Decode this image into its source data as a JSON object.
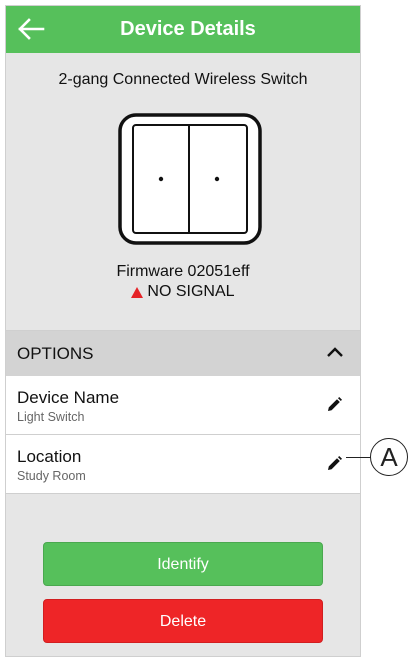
{
  "header": {
    "title": "Device Details",
    "back_icon": "arrow-left-icon"
  },
  "device": {
    "name": "2-gang Connected Wireless Switch",
    "firmware": "Firmware 02051eff",
    "signal_status": "NO SIGNAL",
    "signal_icon": "warning-triangle-icon"
  },
  "options": {
    "title": "OPTIONS",
    "expanded_icon": "chevron-up-icon",
    "items": [
      {
        "label": "Device Name",
        "value": "Light Switch",
        "icon": "pencil-icon"
      },
      {
        "label": "Location",
        "value": "Study Room",
        "icon": "pencil-icon"
      }
    ]
  },
  "actions": {
    "identify_label": "Identify",
    "delete_label": "Delete"
  },
  "callout": {
    "label": "A"
  },
  "colors": {
    "header_green": "#56c05b",
    "identify_green": "#56c05b",
    "delete_red": "#ee2527",
    "warning_red": "#e52327"
  }
}
